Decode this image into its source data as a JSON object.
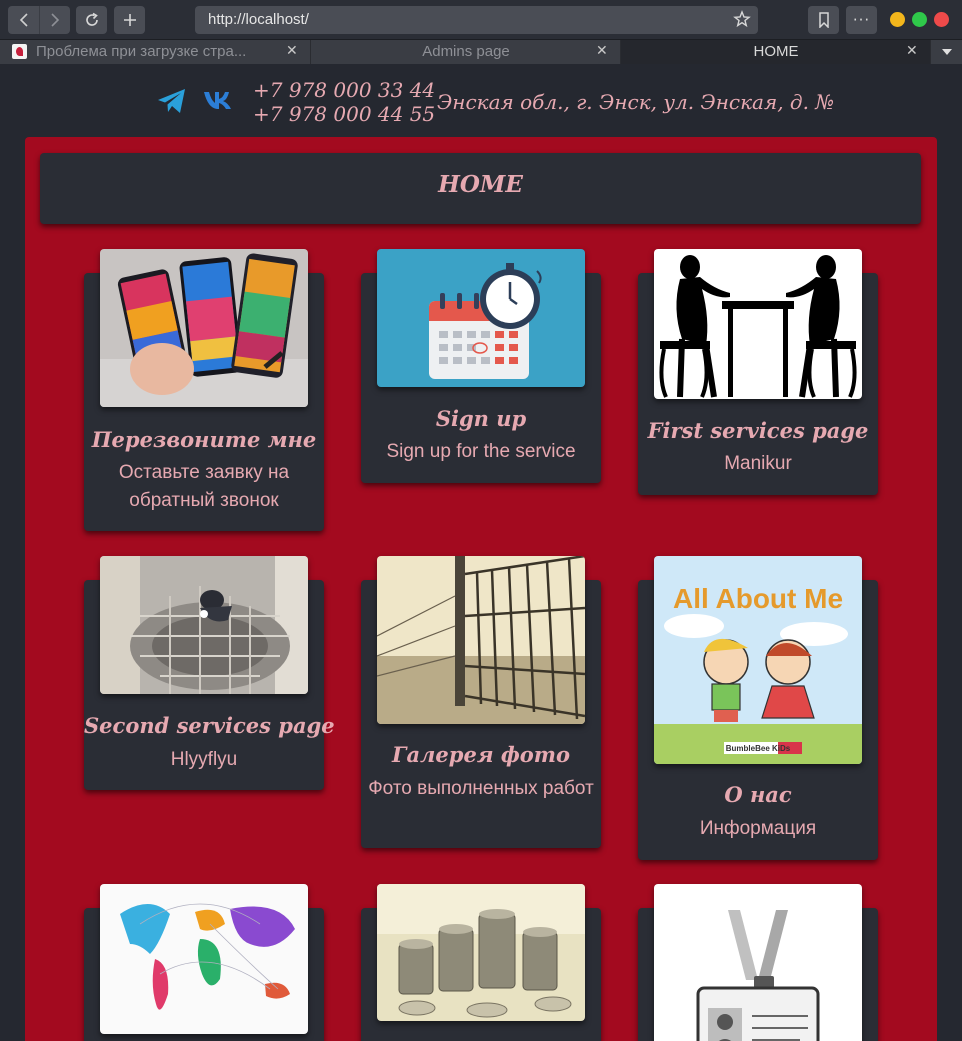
{
  "browser": {
    "url": "http://localhost/",
    "tabs": [
      {
        "title": "Проблема при загрузке стра..."
      },
      {
        "title": "Admins page"
      },
      {
        "title": "HOME"
      }
    ]
  },
  "header": {
    "phone_1": "+7 978 000 33 44",
    "phone_2": "+7 978 000 44 55",
    "address": "Энская обл., г. Энск, ул. Энская, д. №",
    "icons": [
      "telegram-icon",
      "vk-icon"
    ]
  },
  "page_title": "HOME",
  "cards": [
    {
      "title": "Перезвоните мне",
      "desc": "Оставьте заявку на обратный звонок",
      "image": "smartphones-image"
    },
    {
      "title": "Sign up",
      "desc": "Sign up for the service",
      "image": "calendar-stopwatch-image"
    },
    {
      "title": "First services page",
      "desc": "Manikur",
      "image": "manicure-silhouette-image"
    },
    {
      "title": "Second services page",
      "desc": "Hlyyflyu",
      "image": "welder-image"
    },
    {
      "title": "Галерея фото",
      "desc": "Фото выполненных работ",
      "image": "fence-image"
    },
    {
      "title": "О нас",
      "desc": "Информация",
      "image": "all-about-me-image",
      "image_text": {
        "headline": "All About Me",
        "brand": "BumbleBee KiDs"
      }
    },
    {
      "title": "",
      "desc": "",
      "image": "world-map-image"
    },
    {
      "title": "",
      "desc": "",
      "image": "coins-image"
    },
    {
      "title": "",
      "desc": "",
      "image": "id-badge-image"
    }
  ],
  "colors": {
    "background": "#252830",
    "panel_red": "#a30a1f",
    "card": "#2a2d35",
    "text_pink": "#e6a9b1",
    "telegram_blue": "#2aa0da",
    "vk_blue": "#2c7ed6"
  }
}
